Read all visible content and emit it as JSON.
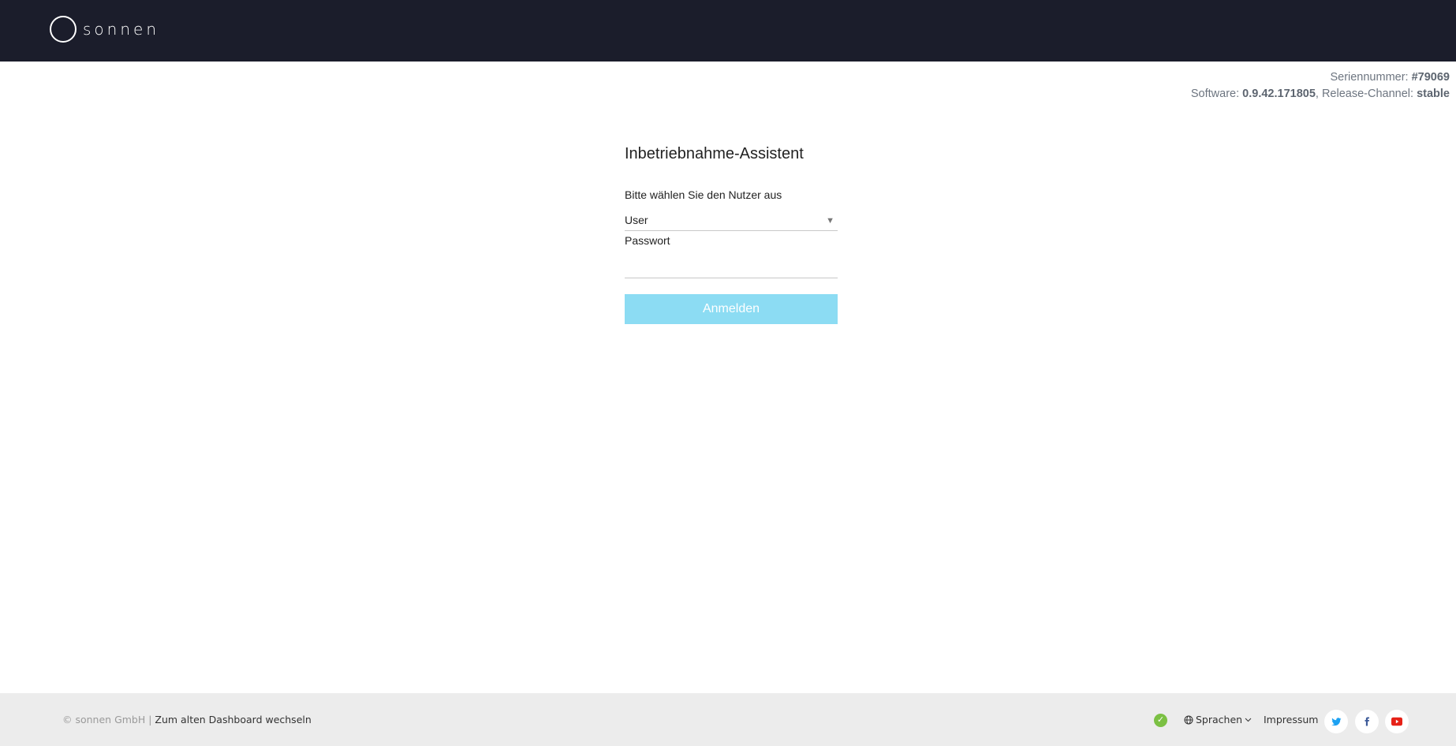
{
  "header": {
    "brand": "sonnen"
  },
  "info": {
    "serial_label": "Seriennummer: ",
    "serial_value": "#79069",
    "software_label": "Software: ",
    "software_value": "0.9.42.171805",
    "channel_label": ", Release-Channel: ",
    "channel_value": "stable"
  },
  "form": {
    "title": "Inbetriebnahme-Assistent",
    "user_select_label": "Bitte wählen Sie den Nutzer aus",
    "user_select_value": "User",
    "password_label": "Passwort",
    "password_value": "",
    "submit_label": "Anmelden"
  },
  "footer": {
    "copyright": "© sonnen GmbH |",
    "old_dashboard_link": " Zum alten Dashboard wechseln",
    "languages_label": "Sprachen",
    "impressum_label": "Impressum"
  },
  "colors": {
    "topbar": "#1b1d2b",
    "button": "#8cdcf3",
    "footer": "#ececec",
    "twitter": "#1da1f2",
    "facebook": "#3b5998",
    "youtube": "#e62117",
    "status": "#7bc043"
  },
  "icons": [
    "sonnen-logo-icon",
    "chevron-down-icon",
    "check-circle-icon",
    "globe-icon",
    "twitter-icon",
    "facebook-icon",
    "youtube-icon"
  ]
}
